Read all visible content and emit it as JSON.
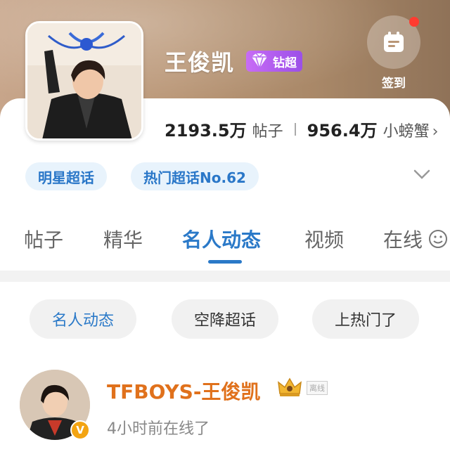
{
  "profile": {
    "name": "王俊凯",
    "badge_label": "钻超",
    "checkin_label": "签到",
    "stats": [
      {
        "value": "2193.5万",
        "label": "帖子"
      },
      {
        "value": "956.4万",
        "label": "小螃蟹"
      }
    ],
    "tags": [
      "明星超话",
      "热门超话No.62"
    ]
  },
  "tabs": [
    "帖子",
    "精华",
    "名人动态",
    "视频",
    "在线"
  ],
  "active_tab": "名人动态",
  "filters": [
    "名人动态",
    "空降超话",
    "上热门了"
  ],
  "active_filter": "名人动态",
  "post": {
    "user_name": "TFBOYS-王俊凯",
    "status_badge": "离线",
    "time_text": "4小时前在线了",
    "verified_badge": "V"
  },
  "colors": {
    "accent": "#2a79c8",
    "username": "#e0711c",
    "tag_bg": "#e8f3fc",
    "badge": "#9b4fe8",
    "notify_dot": "#ff3b30"
  },
  "icons": [
    "calendar-icon",
    "diamond-icon",
    "chevron-right-icon",
    "chevron-down-icon",
    "smiley-icon",
    "crown-icon",
    "verified-icon"
  ]
}
